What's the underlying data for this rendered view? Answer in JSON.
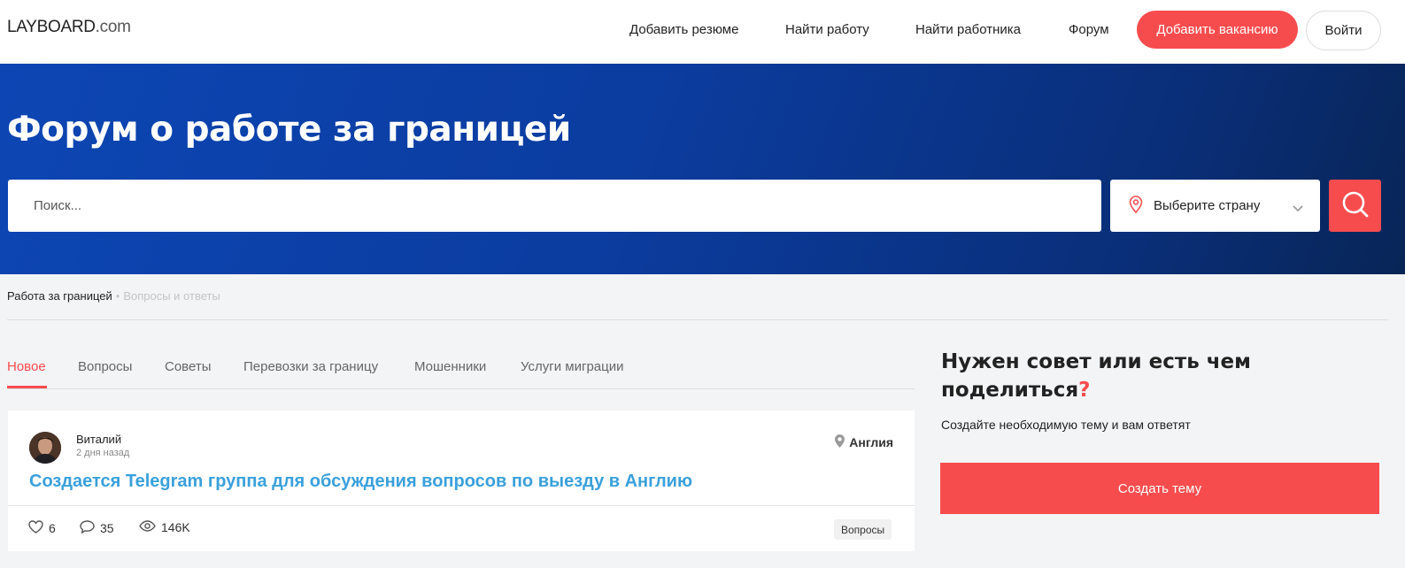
{
  "header": {
    "logo_main": "LAYBOARD",
    "logo_domain": ".com",
    "nav": [
      {
        "label": "Добавить резюме"
      },
      {
        "label": "Найти работу"
      },
      {
        "label": "Найти работника"
      },
      {
        "label": "Форум"
      }
    ],
    "add_vacancy_label": "Добавить вакансию",
    "login_label": "Войти"
  },
  "hero": {
    "title": "Форум о работе за границей",
    "search_placeholder": "Поиск...",
    "country_label": "Выберите страну"
  },
  "breadcrumb": {
    "root": "Работа за границей",
    "separator": "•",
    "current": "Вопросы и ответы"
  },
  "tabs": [
    {
      "label": "Новое",
      "active": true
    },
    {
      "label": "Вопросы"
    },
    {
      "label": "Советы"
    },
    {
      "label": "Перевозки за границу"
    },
    {
      "label": "Мошенники"
    },
    {
      "label": "Услуги миграции"
    }
  ],
  "post": {
    "author": "Виталий",
    "time": "2 дня назад",
    "location": "Англия",
    "title": "Создается Telegram группа для обсуждения вопросов по выезду в Англию",
    "likes": "6",
    "comments": "35",
    "views": "146K",
    "tag": "Вопросы"
  },
  "sidebar": {
    "title": "Нужен совет или есть чем поделиться",
    "title_mark": "?",
    "description": "Создайте необходимую тему и вам ответят",
    "button_label": "Создать тему"
  },
  "colors": {
    "accent": "#f74c4e",
    "hero_blue": "#0d46b4",
    "link_blue": "#3aa0dc"
  }
}
